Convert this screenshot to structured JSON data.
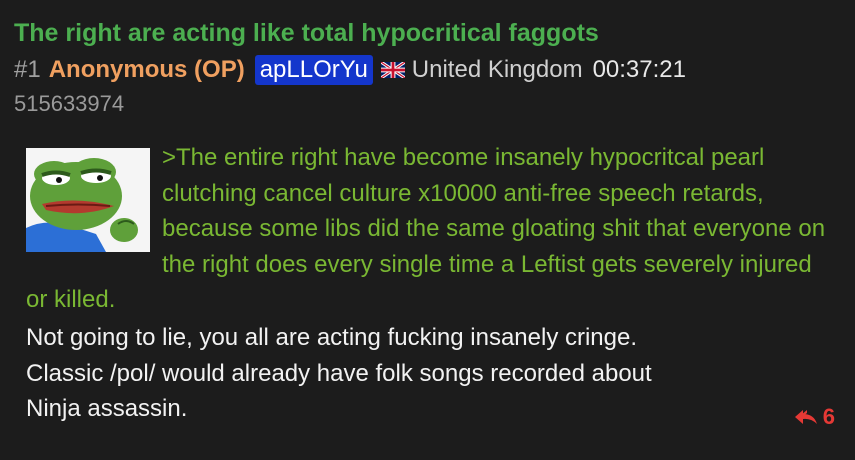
{
  "post": {
    "subject": "The right are acting like total hypocritical faggots",
    "index": "#1",
    "name": "Anonymous (OP)",
    "poster_id": "apLLOrYu",
    "country": "United Kingdom",
    "time": "00:37:21",
    "post_number": "515633974",
    "greentext": ">The entire right have become insanely hypocritcal pearl clutching cancel culture x10000 anti-free speech retards, because some libs did the same gloating shit that everyone on the right does every single time a Leftist gets severely injured or killed.",
    "body_lines": [
      "Not going to lie, you all are acting fucking insanely cringe.",
      "Classic /pol/ would already have folk songs recorded about",
      "Ninja assassin."
    ],
    "reply_count": "6",
    "thumbnail_icon": "pepe-frog-image",
    "flag_icon": "uk-flag-icon",
    "reply_icon": "reply-arrows-icon"
  },
  "colors": {
    "background": "#1c1c1c",
    "subject": "#4caf50",
    "name": "#f0a060",
    "id_badge": "#1436cc",
    "greentext": "#7ab833",
    "reply_count": "#e53935"
  }
}
